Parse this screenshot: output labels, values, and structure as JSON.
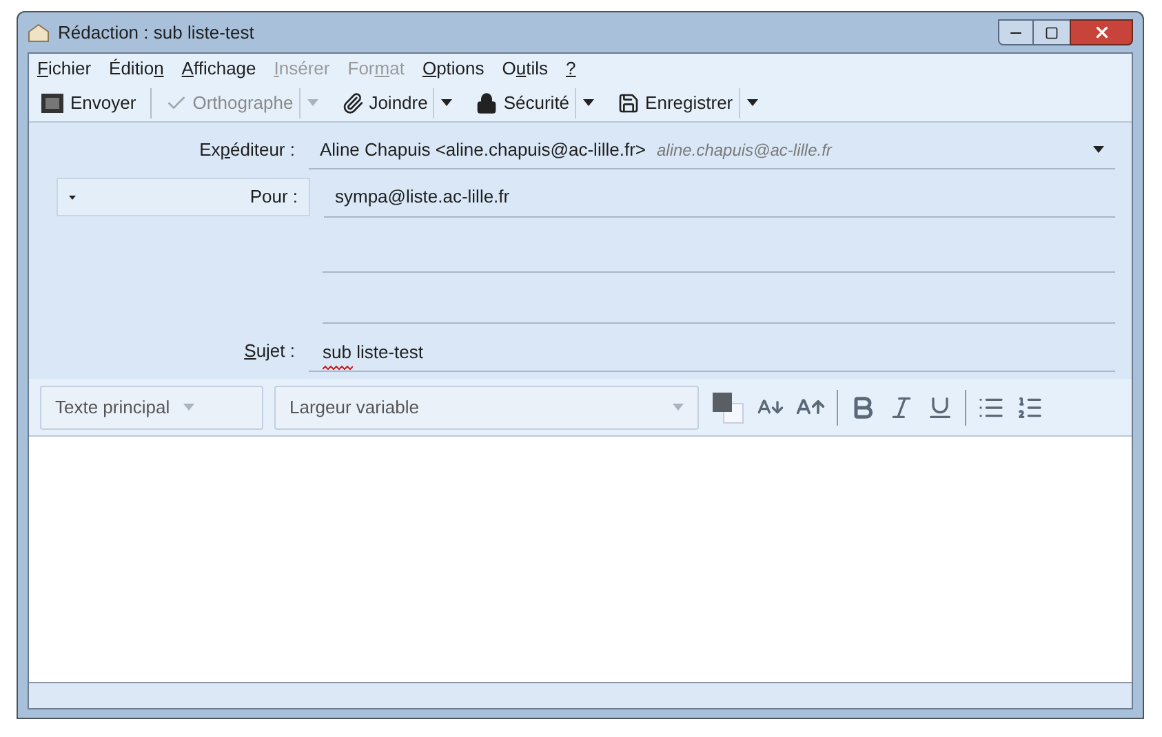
{
  "window": {
    "title": "Rédaction : sub liste-test"
  },
  "menu": [
    {
      "key": "F",
      "post": "ichier",
      "disabled": false
    },
    {
      "pre": "Éditio",
      "key": "n",
      "disabled": false
    },
    {
      "key": "A",
      "post": "ffichage",
      "disabled": false
    },
    {
      "key": "I",
      "post": "nsérer",
      "disabled": true
    },
    {
      "pre": "For",
      "key": "m",
      "post": "at",
      "disabled": true
    },
    {
      "key": "O",
      "post": "ptions",
      "disabled": false
    },
    {
      "pre": "O",
      "key": "u",
      "post": "tils",
      "disabled": false
    },
    {
      "key": "?",
      "disabled": false
    }
  ],
  "toolbar": [
    {
      "kind": "send",
      "label": "Envoyer",
      "disabled": false,
      "dropdown": false
    },
    {
      "kind": "spell",
      "label": "Orthographe",
      "disabled": true,
      "dropdown": true
    },
    {
      "kind": "attach",
      "label": "Joindre",
      "disabled": false,
      "dropdown": true
    },
    {
      "kind": "security",
      "label": "Sécurité",
      "disabled": false,
      "dropdown": true
    },
    {
      "kind": "save",
      "label": "Enregistrer",
      "disabled": false,
      "dropdown": true
    }
  ],
  "sender": {
    "label": {
      "pre": "Ex",
      "key": "p",
      "post": "éditeur :"
    },
    "value": "Aline Chapuis <aline.chapuis@ac-lille.fr>",
    "hint": "aline.chapuis@ac-lille.fr"
  },
  "recipients": [
    {
      "type": "Pour :",
      "value": "sympa@liste.ac-lille.fr"
    }
  ],
  "subject": {
    "label": {
      "key": "S",
      "post": "ujet :"
    },
    "value": "sub liste-test",
    "spelling_error": true
  },
  "format_bar": {
    "paragraph": "Texte principal",
    "font": "Largeur variable"
  }
}
